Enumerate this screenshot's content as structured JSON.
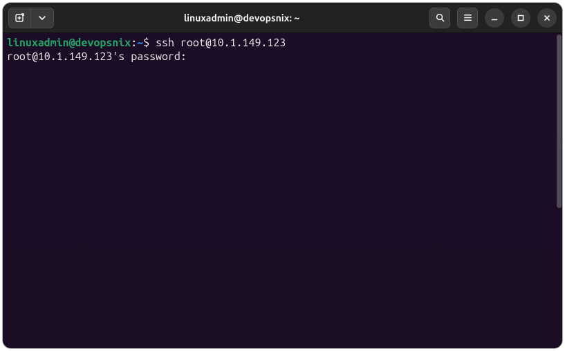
{
  "window": {
    "title": "linuxadmin@devopsnix: ~"
  },
  "terminal": {
    "prompt": {
      "user_host": "linuxadmin@devopsnix",
      "separator": ":",
      "path": "~",
      "symbol": "$"
    },
    "command": "ssh root@10.1.149.123",
    "output_line": "root@10.1.149.123's password:"
  },
  "colors": {
    "prompt_user": "#26a269",
    "prompt_path": "#2a7bde",
    "terminal_bg": "#1c0d26",
    "titlebar_bg": "#222222"
  }
}
